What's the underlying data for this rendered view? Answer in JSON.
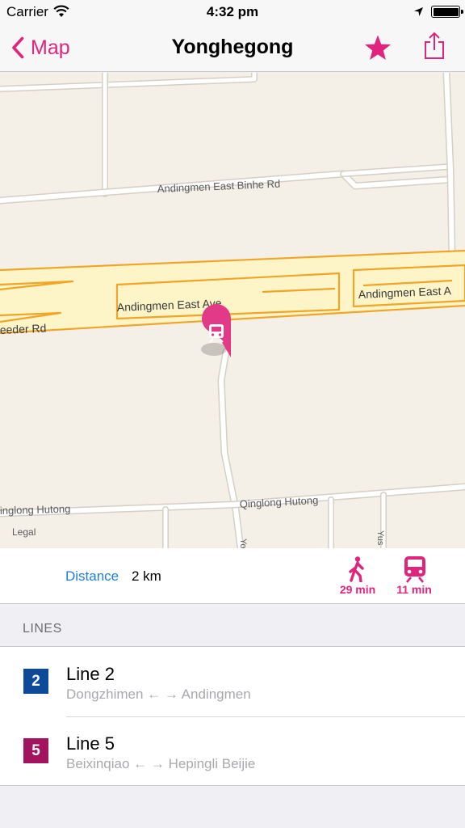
{
  "status_bar": {
    "carrier": "Carrier",
    "time": "4:32 pm",
    "battery_level": 1.0
  },
  "nav": {
    "back_label": "Map",
    "title": "Yonghegong",
    "accent": "#e0247e"
  },
  "map": {
    "street_labels": {
      "binhe": "Andingmen East Binhe Rd",
      "ave_main": "Andingmen East Ave",
      "ave_right": "Andingmen East A",
      "feeder": "eeder Rd",
      "qinglong_left": "inglong Hutong",
      "qinglong_right": "Qinglong Hutong",
      "vertical_a": "Yo",
      "vertical_b": "Yus"
    },
    "legal": "Legal",
    "pin_icon": "subway-train-icon"
  },
  "info": {
    "distance_label": "Distance",
    "distance_value": "2 km",
    "walk_time": "29 min",
    "transit_time": "11 min"
  },
  "lines_section": {
    "header": "LINES"
  },
  "lines": [
    {
      "number": "2",
      "name": "Line 2",
      "route": "Dongzhimen ← → Andingmen",
      "color": "#0d4a9a"
    },
    {
      "number": "5",
      "name": "Line 5",
      "route": "Beixinqiao ← → Hepingli Beijie",
      "color": "#a3135e"
    }
  ]
}
